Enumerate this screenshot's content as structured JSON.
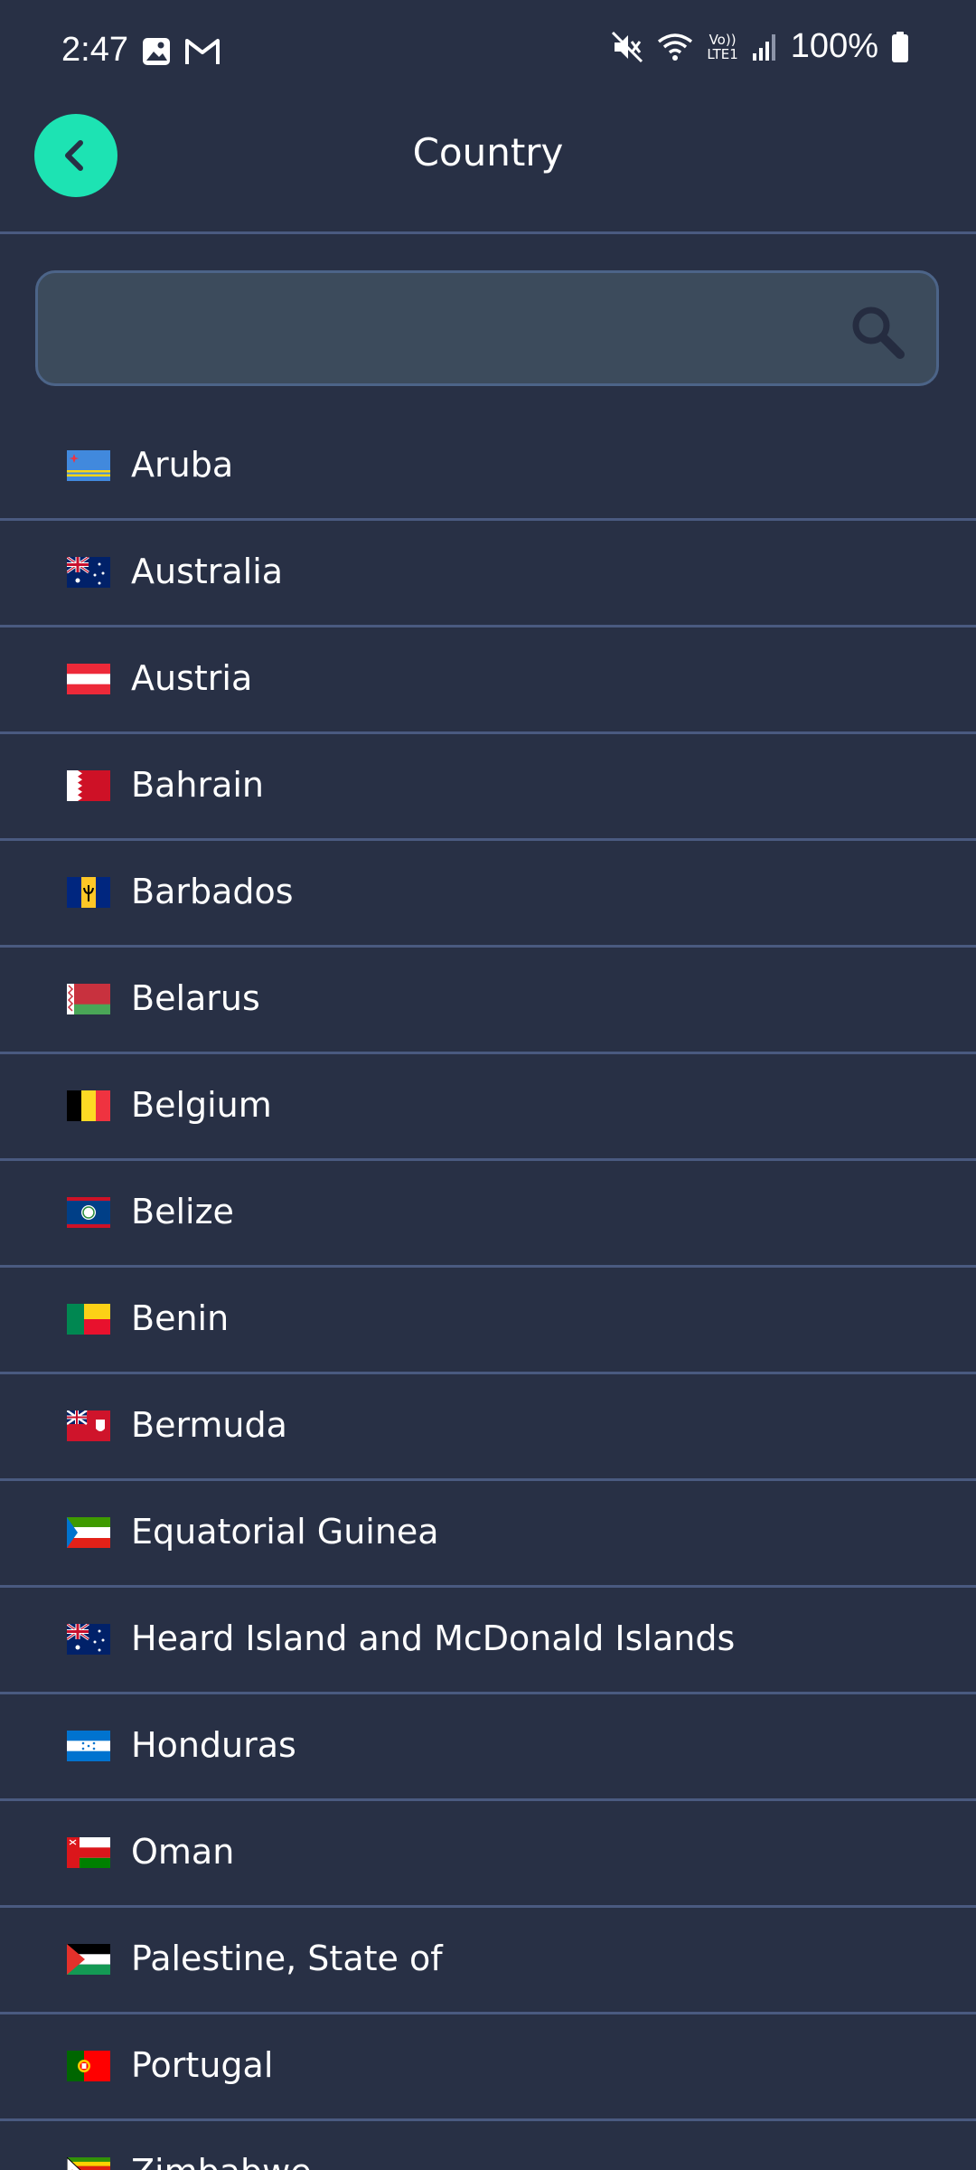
{
  "status_bar": {
    "time": "2:47",
    "battery": "100%",
    "network_label_top": "Vo))",
    "network_label_bottom": "LTE1"
  },
  "header": {
    "title": "Country",
    "back_icon": "chevron-left-icon",
    "accent_color": "#1de3b3"
  },
  "search": {
    "value": "",
    "placeholder": "",
    "icon": "search-icon"
  },
  "countries": [
    {
      "name": "Aruba",
      "flag": "aruba"
    },
    {
      "name": "Australia",
      "flag": "australia"
    },
    {
      "name": "Austria",
      "flag": "austria"
    },
    {
      "name": "Bahrain",
      "flag": "bahrain"
    },
    {
      "name": "Barbados",
      "flag": "barbados"
    },
    {
      "name": "Belarus",
      "flag": "belarus"
    },
    {
      "name": "Belgium",
      "flag": "belgium"
    },
    {
      "name": "Belize",
      "flag": "belize"
    },
    {
      "name": "Benin",
      "flag": "benin"
    },
    {
      "name": "Bermuda",
      "flag": "bermuda"
    },
    {
      "name": "Equatorial Guinea",
      "flag": "equatorial-guinea"
    },
    {
      "name": "Heard Island and McDonald Islands",
      "flag": "australia"
    },
    {
      "name": "Honduras",
      "flag": "honduras"
    },
    {
      "name": "Oman",
      "flag": "oman"
    },
    {
      "name": "Palestine, State of",
      "flag": "palestine"
    },
    {
      "name": "Portugal",
      "flag": "portugal"
    },
    {
      "name": "Zimbabwe",
      "flag": "zimbabwe"
    }
  ]
}
